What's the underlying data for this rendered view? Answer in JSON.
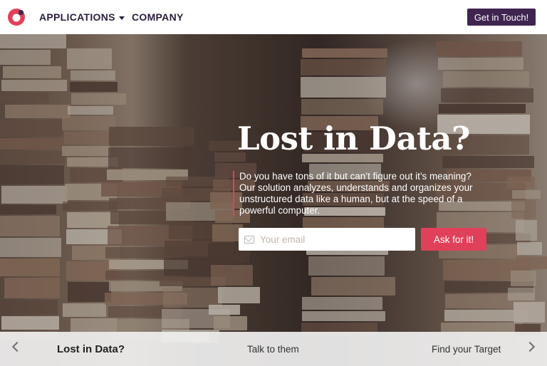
{
  "nav": {
    "logo": "logo-icon",
    "applications_label": "APPLICATIONS",
    "company_label": "COMPANY",
    "cta_label": "Get in Touch!"
  },
  "hero": {
    "title": "Lost in Data?",
    "description": "Do you have tons of it but can’t figure out it’s meaning? Our solution analyzes, understands and organizes your unstructured data like a human, but at the speed of a powerful computer.",
    "email_placeholder": "Your email",
    "ask_label": "Ask for it!"
  },
  "carousel": {
    "items": [
      "Lost in Data?",
      "Talk to them",
      "Find your Target"
    ],
    "active_index": 0
  },
  "colors": {
    "accent": "#e0405a",
    "brand_dark": "#3f2450"
  }
}
